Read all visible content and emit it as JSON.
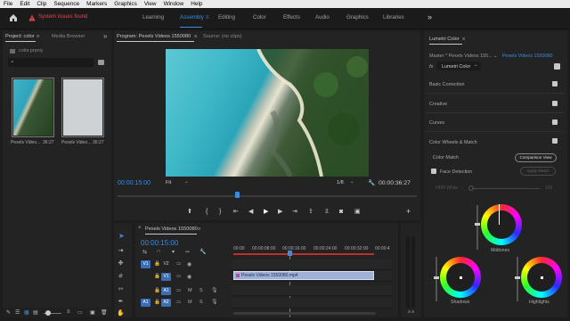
{
  "menu": [
    "File",
    "Edit",
    "Clip",
    "Sequence",
    "Markers",
    "Graphics",
    "View",
    "Window",
    "Help"
  ],
  "warning": "System issues found",
  "workspaces": [
    {
      "label": "Learning",
      "active": false
    },
    {
      "label": "Assembly",
      "active": true
    },
    {
      "label": "Editing",
      "active": false
    },
    {
      "label": "Color",
      "active": false
    },
    {
      "label": "Effects",
      "active": false
    },
    {
      "label": "Audio",
      "active": false
    },
    {
      "label": "Graphics",
      "active": false
    },
    {
      "label": "Libraries",
      "active": false
    }
  ],
  "project": {
    "tab": "Project: color",
    "tab2": "Media Browser",
    "file": "color.prproj",
    "clips": [
      {
        "name": "Pexels Video...",
        "duration": "36:27"
      },
      {
        "name": "Pexels Video...",
        "duration": "36:27"
      }
    ]
  },
  "program": {
    "tab": "Program: Pexels Videos 1550080",
    "tab2": "Source: (no clips)",
    "timecode": "00:00:15:00",
    "fit": "Fit",
    "scale": "1/8",
    "duration": "00:00:36:27"
  },
  "timeline": {
    "tab": "Pexels Videos 1550080",
    "timecode": "00:00:15:00",
    "ruler": [
      "00:00",
      "00:00:08:00",
      "00:00:16:00",
      "00:00:24:00",
      "00:00:32:00",
      "00:00:4"
    ],
    "tracks": {
      "v2": "V2",
      "v1": "V1",
      "v1src": "V1",
      "a1": "A1",
      "a1src": "A1",
      "a2": "A2",
      "a2src": "A2",
      "m": "M",
      "s": "S"
    },
    "clip": "Pexels Videos 1550080.mp4",
    "meter": "S S"
  },
  "lumetri": {
    "tab": "Lumetri Color",
    "master": "Master * Pexels Videos 155...",
    "seq": "Pexels Videos 1550080",
    "fx_label": "fx",
    "fx_name": "Lumetri Color",
    "sections": [
      "Basic Correction",
      "Creative",
      "Curves",
      "Color Wheels & Match"
    ],
    "color_match": "Color Match",
    "comparison": "Comparison View",
    "face": "Face Detection",
    "apply": "Apply Match",
    "hdr": "HDR White",
    "hdr_val": "100",
    "midtones": "Midtones",
    "shadows": "Shadows",
    "highlights": "Highlights"
  }
}
